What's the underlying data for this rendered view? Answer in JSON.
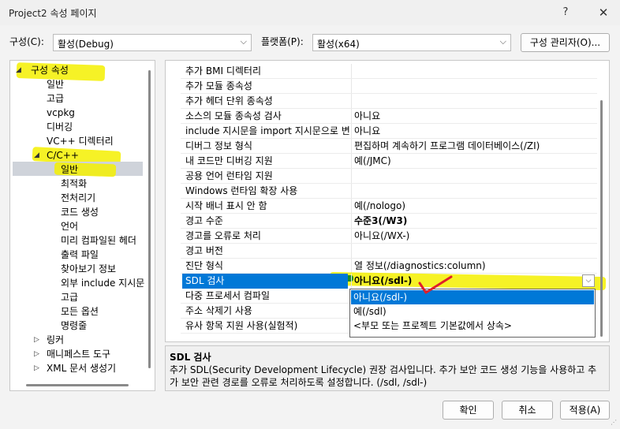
{
  "window": {
    "title": "Project2 속성 페이지",
    "help": "?",
    "close": "✕"
  },
  "toolbar": {
    "config_label": "구성(C):",
    "config_value": "활성(Debug)",
    "platform_label": "플랫폼(P):",
    "platform_value": "활성(x64)",
    "manager_button": "구성 관리자(O)..."
  },
  "tree": {
    "items": [
      {
        "label": "구성 속성",
        "expander": "◢"
      },
      {
        "label": "일반"
      },
      {
        "label": "고급"
      },
      {
        "label": "vcpkg"
      },
      {
        "label": "디버깅"
      },
      {
        "label": "VC++ 디렉터리"
      },
      {
        "label": "C/C++",
        "expander": "◢"
      },
      {
        "label": "일반"
      },
      {
        "label": "최적화"
      },
      {
        "label": "전처리기"
      },
      {
        "label": "코드 생성"
      },
      {
        "label": "언어"
      },
      {
        "label": "미리 컴파일된 헤더"
      },
      {
        "label": "출력 파일"
      },
      {
        "label": "찾아보기 정보"
      },
      {
        "label": "외부 include 지시문"
      },
      {
        "label": "고급"
      },
      {
        "label": "모든 옵션"
      },
      {
        "label": "명령줄"
      },
      {
        "label": "링커",
        "expander": "▷"
      },
      {
        "label": "매니페스트 도구",
        "expander": "▷"
      },
      {
        "label": "XML 문서 생성기",
        "expander": "▷"
      }
    ]
  },
  "grid": {
    "rows": [
      {
        "name": "추가 BMI 디렉터리",
        "value": ""
      },
      {
        "name": "추가 모듈 종속성",
        "value": ""
      },
      {
        "name": "추가 헤더 단위 종속성",
        "value": ""
      },
      {
        "name": "소스의 모듈 종속성 검사",
        "value": "아니요"
      },
      {
        "name": "include 지시문을 import 지시문으로 변",
        "value": "아니요"
      },
      {
        "name": "디버그 정보 형식",
        "value": "편집하며 계속하기 프로그램 데이터베이스(/ZI)"
      },
      {
        "name": "내 코드만 디버깅 지원",
        "value": "예(/JMC)"
      },
      {
        "name": "공용 언어 런타임 지원",
        "value": ""
      },
      {
        "name": "Windows 런타임 확장 사용",
        "value": ""
      },
      {
        "name": "시작 배너 표시 안 함",
        "value": "예(/nologo)"
      },
      {
        "name": "경고 수준",
        "value": "수준3(/W3)"
      },
      {
        "name": "경고를 오류로 처리",
        "value": "아니요(/WX-)"
      },
      {
        "name": "경고 버전",
        "value": ""
      },
      {
        "name": "진단 형식",
        "value": "열 정보(/diagnostics:column)"
      },
      {
        "name": "SDL 검사",
        "value": "아니요(/sdl-)"
      },
      {
        "name": "다중 프로세서 컴파일",
        "value": ""
      },
      {
        "name": "주소 삭제기 사용",
        "value": ""
      },
      {
        "name": "유사 항목 지원 사용(실험적)",
        "value": ""
      }
    ],
    "dropdown_options": [
      "아니요(/sdl-)",
      "예(/sdl)",
      "<부모 또는 프로젝트 기본값에서 상속>"
    ]
  },
  "description": {
    "title": "SDL 검사",
    "text": "추가 SDL(Security Development Lifecycle) 권장 검사입니다. 추가 보안 코드 생성 기능을 사용하고 추가 보안 관련 경로를 오류로 처리하도록 설정합니다. (/sdl, /sdl-)"
  },
  "buttons": {
    "ok": "확인",
    "cancel": "취소",
    "apply": "적용(A)"
  },
  "colors": {
    "selection": "#0078d7",
    "highlighter": "#f4f000",
    "checkmark": "#e0202a"
  }
}
